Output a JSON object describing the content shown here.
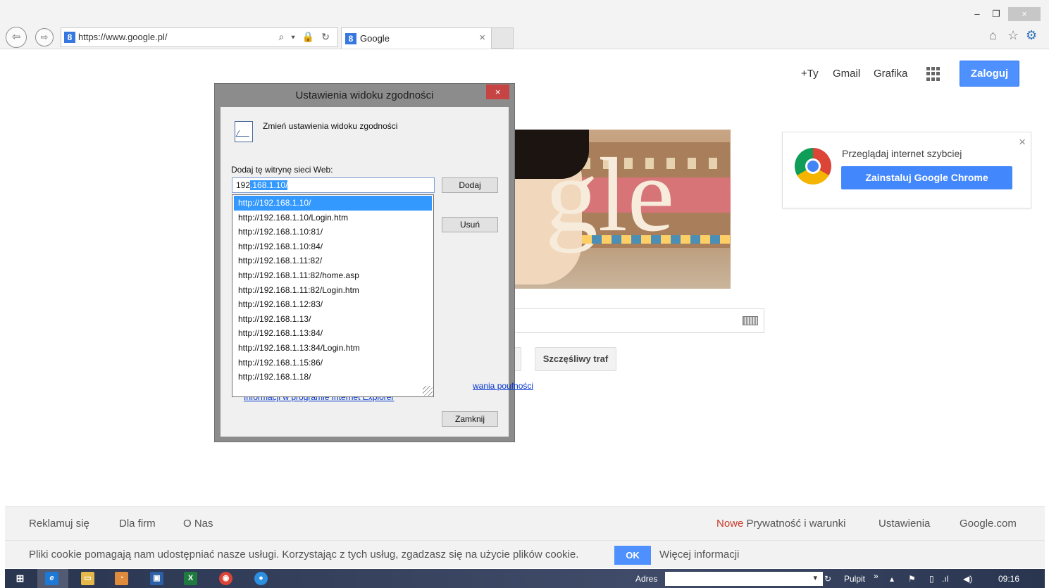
{
  "browser": {
    "url": "https://www.google.pl/",
    "tab_title": "Google",
    "favicon_letter": "8",
    "addr_controls": "⌕ ▾ 🔒 ↻",
    "tab_close": "×",
    "window_buttons": {
      "minimize": "–",
      "restore": "❐",
      "close": "×"
    },
    "tools_icons": [
      "home-icon",
      "star-icon",
      "gear-icon"
    ]
  },
  "google_header": {
    "links": [
      "+Ty",
      "Gmail",
      "Grafika"
    ],
    "signin_label": "Zaloguj"
  },
  "doodle": {
    "text": "gle"
  },
  "search_buttons": {
    "lucky": "Szczęśliwy traf"
  },
  "chrome_promo": {
    "text": "Przeglądaj internet szybciej",
    "button": "Zainstaluj Google Chrome",
    "close": "×"
  },
  "footer": {
    "left_links": [
      "Reklamuj się",
      "Dla firm",
      "O Nas"
    ],
    "new_label": "Nowe",
    "privacy": "Prywatność i warunki",
    "settings": "Ustawienia",
    "google_com": "Google.com"
  },
  "cookie_bar": {
    "message": "Pliki cookie pomagają nam udostępniać nasze usługi. Korzystając z tych usług, zgadzasz się na użycie plików cookie.",
    "ok": "OK",
    "more": "Więcej informacji"
  },
  "dialog": {
    "title": "Ustawienia widoku zgodności",
    "close": "×",
    "heading": "Zmień ustawienia widoku zgodności",
    "add_label": "Dodaj tę witrynę sieci Web:",
    "input_typed": "192",
    "input_selected": ".168.1.10/",
    "add_button": "Dodaj",
    "remove_button": "Usuń",
    "link_privacy": "wania poufności",
    "link_info": "Informacji w programie Internet Explorer",
    "close_button": "Zamknij",
    "suggestions": [
      "http://192.168.1.10/",
      "http://192.168.1.10/Login.htm",
      "http://192.168.1.10:81/",
      "http://192.168.1.10:84/",
      "http://192.168.1.11:82/",
      "http://192.168.1.11:82/home.asp",
      "http://192.168.1.11:82/Login.htm",
      "http://192.168.1.12:83/",
      "http://192.168.1.13/",
      "http://192.168.1.13:84/",
      "http://192.168.1.13:84/Login.htm",
      "http://192.168.1.15:86/",
      "http://192.168.1.18/"
    ],
    "selected_index": 0
  },
  "taskbar": {
    "address_label": "Adres",
    "desktop_label": "Pulpit",
    "chevron": "»",
    "clock": "09:16",
    "accent": "#2a3550"
  }
}
